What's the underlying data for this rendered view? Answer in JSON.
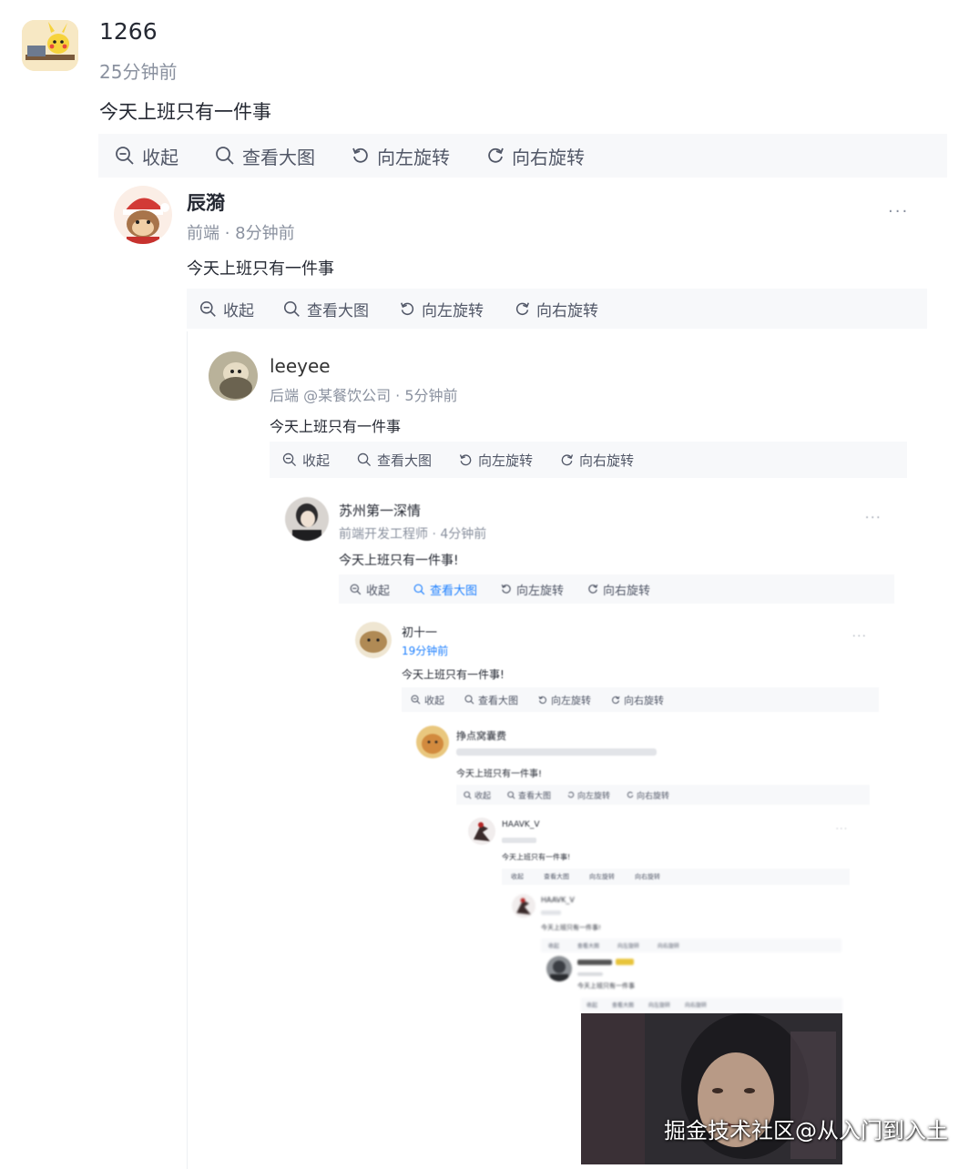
{
  "toolbar_labels": {
    "collapse": "收起",
    "view_large": "查看大图",
    "rotate_left": "向左旋转",
    "rotate_right": "向右旋转"
  },
  "posts": [
    {
      "name": "1266",
      "meta": "25分钟前",
      "text": "今天上班只有一件事"
    },
    {
      "name": "辰漪",
      "meta": "前端 · 8分钟前",
      "text": "今天上班只有一件事"
    },
    {
      "name": "leeyee",
      "meta": "后端 @某餐饮公司 · 5分钟前",
      "text": "今天上班只有一件事"
    },
    {
      "name": "苏州第一深情",
      "meta": "前端开发工程师 · 4分钟前",
      "text": "今天上班只有一件事!"
    },
    {
      "name": "初十一",
      "meta": "19分钟前",
      "text": "今天上班只有一件事!"
    },
    {
      "name": "挣点窝囊费",
      "meta": "",
      "text": "今天上班只有一件事!"
    },
    {
      "name": "HAAVK_V",
      "meta": "",
      "text": "今天上班只有一件事!"
    },
    {
      "name": "HAAVK_V",
      "meta": "",
      "text": "今天上班只有一件事!"
    },
    {
      "name": "",
      "meta": "",
      "text": "今天上班只有一件事"
    }
  ],
  "more_icon": "···",
  "watermark": "掘金技术社区@从入门到入土",
  "colors": {
    "text": "#252933",
    "meta": "#8a919f",
    "toolbar_bg": "#f7f8fa",
    "link": "#1e80ff"
  }
}
